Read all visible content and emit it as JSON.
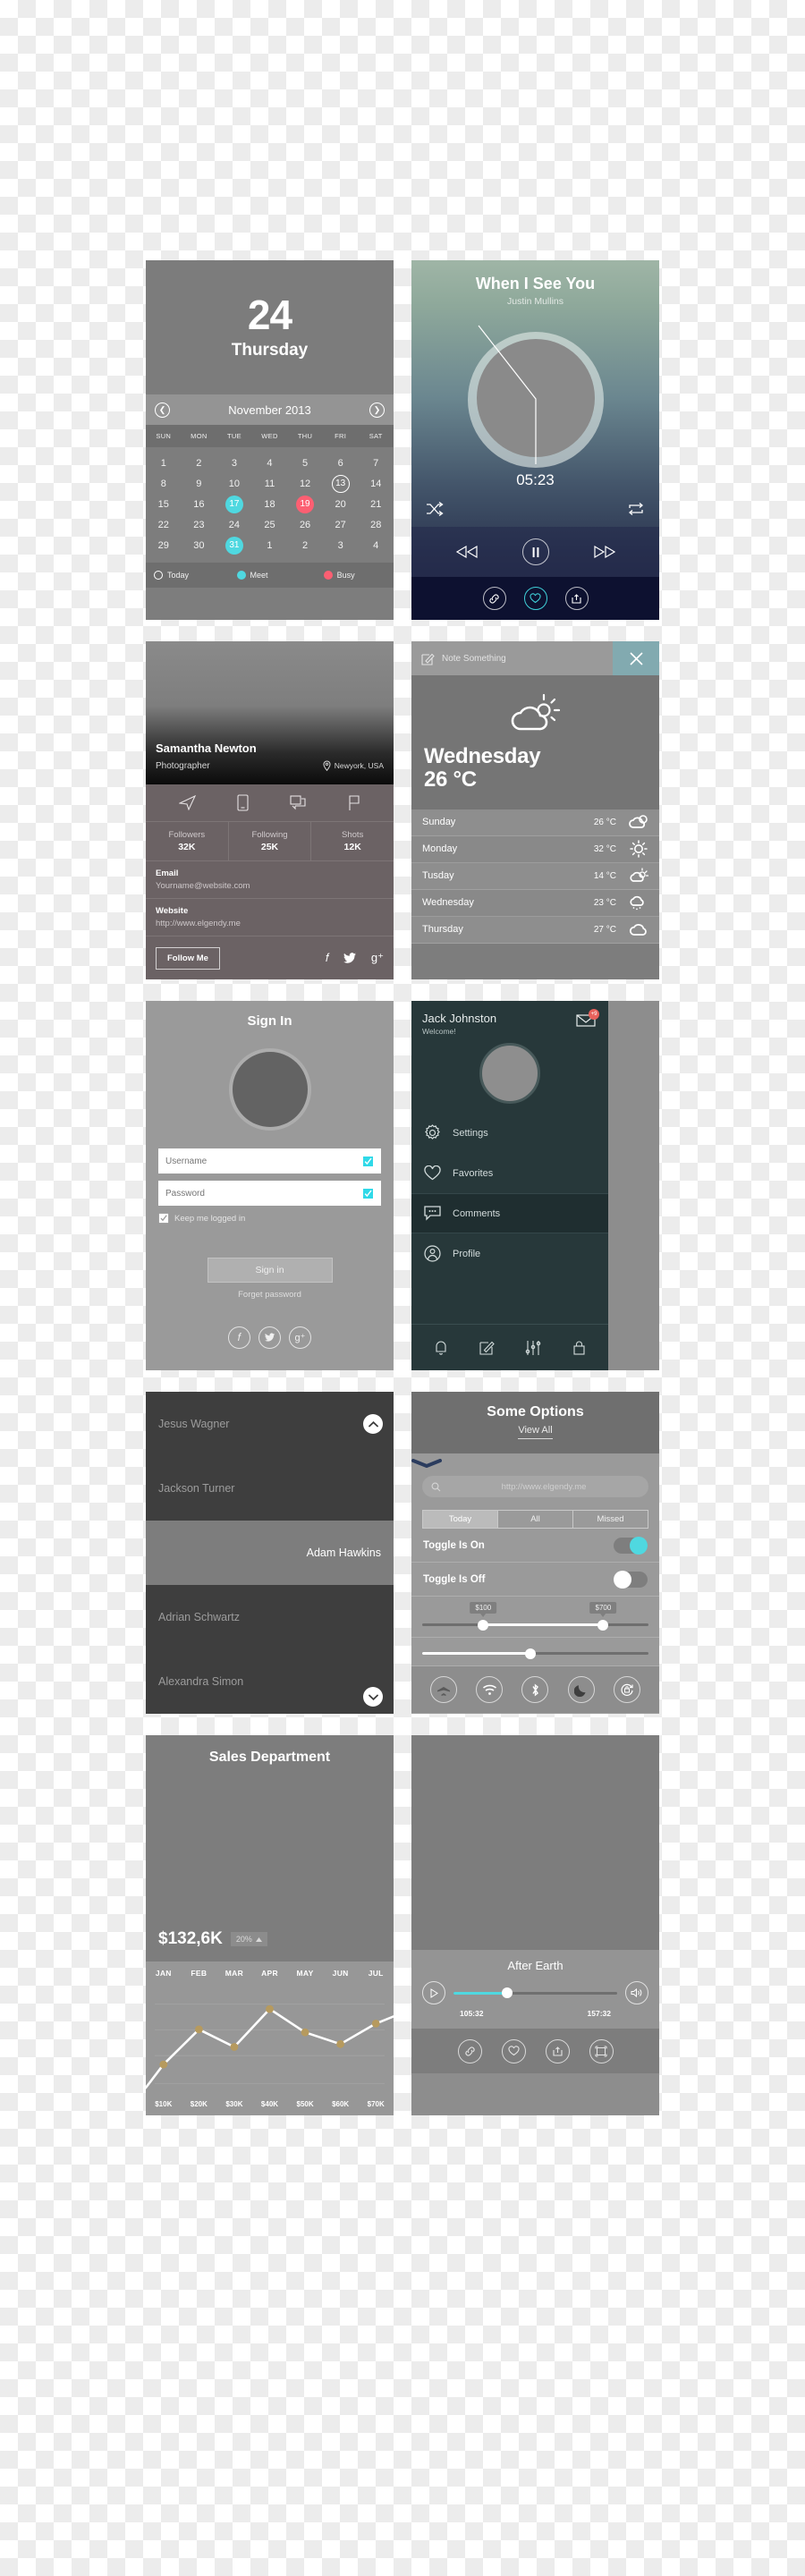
{
  "calendar": {
    "day_number": "24",
    "day_name": "Thursday",
    "month_label": "November 2013",
    "prev_icon": "chevron-left-icon",
    "next_icon": "chevron-right-icon",
    "weekdays": [
      "SUN",
      "MON",
      "TUE",
      "WED",
      "THU",
      "FRI",
      "SAT"
    ],
    "cells": [
      {
        "d": "1"
      },
      {
        "d": "2"
      },
      {
        "d": "3"
      },
      {
        "d": "4"
      },
      {
        "d": "5"
      },
      {
        "d": "6"
      },
      {
        "d": "7"
      },
      {
        "d": "8"
      },
      {
        "d": "9"
      },
      {
        "d": "10"
      },
      {
        "d": "11"
      },
      {
        "d": "12"
      },
      {
        "d": "13",
        "s": "today"
      },
      {
        "d": "14"
      },
      {
        "d": "15"
      },
      {
        "d": "16"
      },
      {
        "d": "17",
        "s": "meet"
      },
      {
        "d": "18"
      },
      {
        "d": "19",
        "s": "busy"
      },
      {
        "d": "20"
      },
      {
        "d": "21"
      },
      {
        "d": "22"
      },
      {
        "d": "23"
      },
      {
        "d": "24"
      },
      {
        "d": "25"
      },
      {
        "d": "26"
      },
      {
        "d": "27"
      },
      {
        "d": "28"
      },
      {
        "d": "29"
      },
      {
        "d": "30"
      },
      {
        "d": "31",
        "s": "meet"
      },
      {
        "d": "1"
      },
      {
        "d": "2"
      },
      {
        "d": "3"
      },
      {
        "d": "4"
      }
    ],
    "legend": [
      {
        "label": "Today",
        "type": "ring"
      },
      {
        "label": "Meet",
        "type": "cyan"
      },
      {
        "label": "Busy",
        "type": "red"
      }
    ],
    "colors": {
      "meet": "#4fd8e0",
      "busy": "#fc5f72"
    }
  },
  "music": {
    "title": "When I See You",
    "artist": "Justin Mullins",
    "time": "05:23",
    "shuffle_icon": "shuffle-icon",
    "repeat_icon": "repeat-icon",
    "prev_icon": "rewind-icon",
    "play_icon": "pause-icon",
    "next_icon": "fast-forward-icon",
    "social": [
      "link-icon",
      "heart-icon",
      "share-icon"
    ],
    "accent": "#3fd0d8"
  },
  "profile": {
    "name": "Samantha Newton",
    "role": "Photographer",
    "location": "Newyork, USA",
    "location_icon": "map-pin-icon",
    "action_icons": [
      "send-icon",
      "phone-icon",
      "chat-icon",
      "flag-icon"
    ],
    "stats": [
      {
        "label": "Followers",
        "value": "32K"
      },
      {
        "label": "Following",
        "value": "25K"
      },
      {
        "label": "Shots",
        "value": "12K"
      }
    ],
    "fields": [
      {
        "label": "Email",
        "value": "Yourname@website.com"
      },
      {
        "label": "Website",
        "value": "http://www.elgendy.me"
      }
    ],
    "follow_label": "Follow Me",
    "social": [
      "facebook-icon",
      "twitter-icon",
      "google-plus-icon"
    ]
  },
  "weather": {
    "note_placeholder": "Note Something",
    "note_icon": "edit-icon",
    "close_icon": "close-icon",
    "close_bg": "#82aab0",
    "hero_icon": "sun-cloud-icon",
    "hero_day": "Wednesday",
    "hero_temp": "26 °C",
    "forecast": [
      {
        "day": "Sunday",
        "temp": "26 °C",
        "icon": "cloud-sun-icon"
      },
      {
        "day": "Monday",
        "temp": "32 °C",
        "icon": "sun-icon"
      },
      {
        "day": "Tusday",
        "temp": "14 °C",
        "icon": "sun-cloud-icon"
      },
      {
        "day": "Wednesday",
        "temp": "23 °C",
        "icon": "rain-cloud-icon"
      },
      {
        "day": "Thursday",
        "temp": "27 °C",
        "icon": "cloud-icon"
      }
    ]
  },
  "signin": {
    "title": "Sign In",
    "avatar": "avatar-placeholder",
    "username_placeholder": "Username",
    "password_placeholder": "Password",
    "field_icon": "checkbox-checked-icon",
    "remember_label": "Keep me logged in",
    "button_label": "Sign in",
    "forget_label": "Forget password",
    "social": [
      "facebook-icon",
      "twitter-icon",
      "google-plus-icon"
    ],
    "accent": "#2fd9e8"
  },
  "drawer": {
    "name": "Jack Johnston",
    "welcome": "Welcome!",
    "mail_icon": "mail-icon",
    "badge": "+9",
    "badge_color": "#e8615b",
    "items": [
      {
        "label": "Settings",
        "icon": "gear-icon",
        "active": false
      },
      {
        "label": "Favorites",
        "icon": "heart-icon",
        "active": false
      },
      {
        "label": "Comments",
        "icon": "comment-icon",
        "active": true
      },
      {
        "label": "Profile",
        "icon": "user-circle-icon",
        "active": false
      }
    ],
    "footer_icons": [
      "bell-icon",
      "edit-icon",
      "sliders-icon",
      "lock-icon"
    ]
  },
  "namelist": {
    "items": [
      {
        "name": "Jesus Wagner",
        "selected": false
      },
      {
        "name": "Jackson Turner",
        "selected": false
      },
      {
        "name": "Adam Hawkins",
        "selected": true
      },
      {
        "name": "Adrian Schwartz",
        "selected": false
      },
      {
        "name": "Alexandra Simon",
        "selected": false
      }
    ],
    "top_chevron": "chevron-up-icon",
    "bottom_chevron": "chevron-down-icon"
  },
  "options": {
    "title": "Some Options",
    "view_all": "View All",
    "search_icon": "search-icon",
    "search_value": "http://www.elgendy.me",
    "segments": [
      "Today",
      "All",
      "Missed"
    ],
    "segment_selected": "Today",
    "toggle_on_label": "Toggle Is On",
    "toggle_off_label": "Toggle Is Off",
    "range_min_label": "$100",
    "range_max_label": "$700",
    "range_min_pct": 27,
    "range_max_pct": 80,
    "volume_pct": 48,
    "quick_icons": [
      "airplane-icon",
      "wifi-icon",
      "bluetooth-icon",
      "moon-icon",
      "rotation-lock-icon"
    ],
    "accent": "#4fd8e0"
  },
  "sales": {
    "title": "Sales Department",
    "amount": "$132,6K",
    "change": "20%",
    "change_icon": "triangle-up-icon"
  },
  "video": {
    "title": "After Earth",
    "play_icon": "play-circle-icon",
    "volume_icon": "volume-icon",
    "current_time": "105:32",
    "total_time": "157:32",
    "progress_pct": 33,
    "accent": "#4fd8e0",
    "footer_icons": [
      "link-icon",
      "heart-icon",
      "share-icon",
      "fullscreen-icon"
    ]
  },
  "chart_data": {
    "type": "line",
    "title": "Sales Department",
    "categories": [
      "JAN",
      "FEB",
      "MAR",
      "APR",
      "MAY",
      "JUN",
      "JUL"
    ],
    "x_axis_top_labels": [
      "JAN",
      "FEB",
      "MAR",
      "APR",
      "MAY",
      "JUN",
      "JUL"
    ],
    "x_axis_bottom_labels": [
      "$10K",
      "$20K",
      "$30K",
      "$40K",
      "$50K",
      "$60K",
      "$70K"
    ],
    "values": [
      14,
      38,
      26,
      52,
      36,
      28,
      42
    ],
    "ylim": [
      0,
      60
    ],
    "xlabel": "",
    "ylabel": "",
    "grid": true,
    "legend": "none",
    "line_color": "#ffffff",
    "marker_color": "#b69a5e",
    "summary_value": "$132,6K",
    "summary_change": "20%"
  }
}
